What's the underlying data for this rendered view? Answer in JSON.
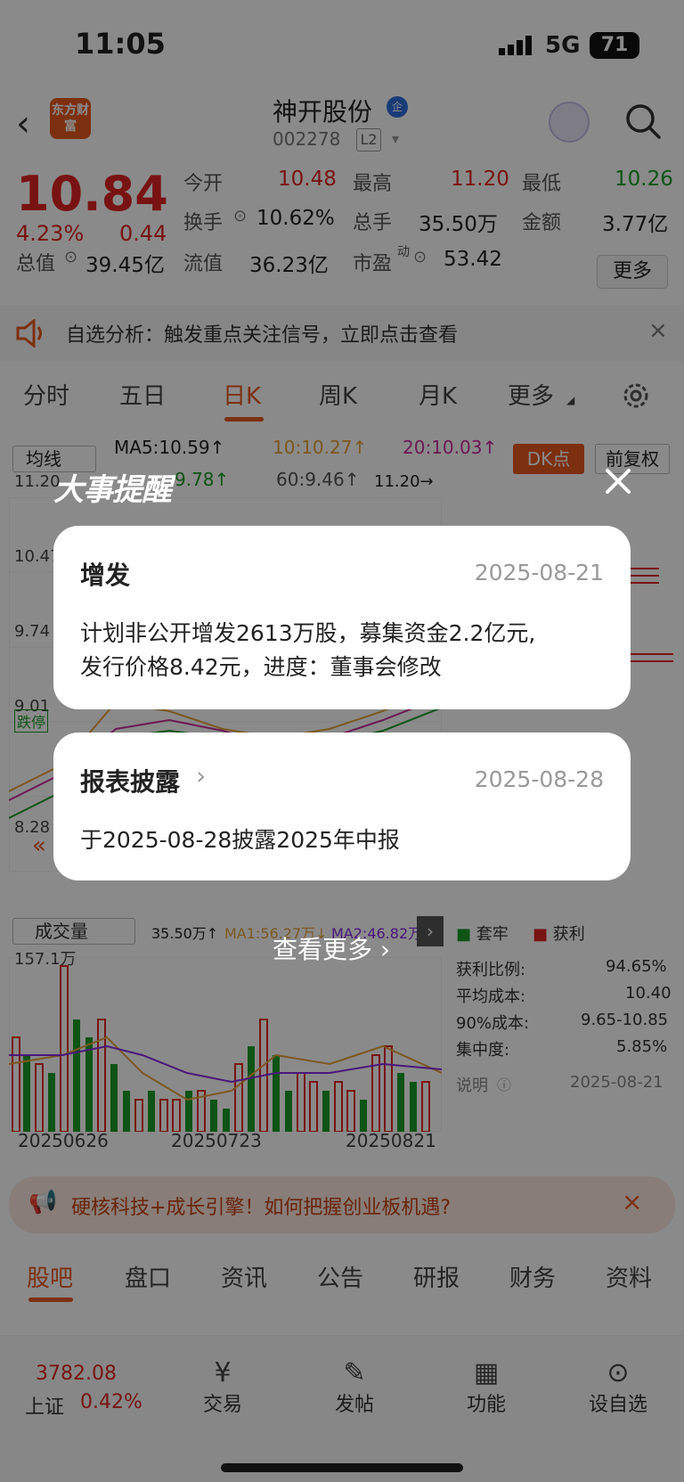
{
  "status_bar": {
    "time": "11:05",
    "network": "5G",
    "battery": "71"
  },
  "header": {
    "logo_text": "东方财富",
    "stock_name": "神开股份",
    "badge": "企",
    "code": "002278",
    "level": "L2"
  },
  "quote": {
    "price": "10.84",
    "change_pct": "4.23%",
    "change": "0.44",
    "open_label": "今开",
    "open": "10.48",
    "high_label": "最高",
    "high": "11.20",
    "low_label": "最低",
    "low": "10.26",
    "turnover_label": "换手",
    "turnover": "10.62%",
    "volume_label": "总手",
    "volume": "35.50万",
    "amount_label": "金额",
    "amount": "3.77亿",
    "mktcap_label": "总值",
    "mktcap": "39.45亿",
    "float_label": "流值",
    "float": "36.23亿",
    "pe_label": "市盈",
    "pe_sup": "动",
    "pe": "53.42",
    "more": "更多"
  },
  "banner_top": {
    "text": "自选分析：触发重点关注信号，立即点击查看"
  },
  "chart_tabs": [
    "分时",
    "五日",
    "日K",
    "周K",
    "月K",
    "更多"
  ],
  "chart": {
    "indicator": "均线",
    "ma5": "MA5:10.59↑",
    "ma10": "10:10.27↑",
    "ma20": "20:10.03↑",
    "ma30": "9.78↑",
    "ma60": "60:9.46↑",
    "dk": "DK点",
    "adjust": "前复权",
    "y_labels": [
      "11.20",
      "10.47",
      "9.74",
      "9.01",
      "8.28"
    ],
    "high_mark": "11.20→",
    "limit_down": "跌停",
    "volume_select": "成交量",
    "vol_total": "35.50万↑",
    "vol_ma1": "MA1:56.27万↓",
    "vol_ma2": "MA2:46.82万",
    "vol_max": "157.1万",
    "dates": [
      "20250626",
      "20250723",
      "20250821"
    ]
  },
  "chip": {
    "legend_trap": "套牢",
    "legend_profit": "获利",
    "rows": [
      {
        "label": "获利比例:",
        "value": "94.65%"
      },
      {
        "label": "平均成本:",
        "value": "10.40"
      },
      {
        "label": "90%成本:",
        "value": "9.65-10.85"
      },
      {
        "label": "集中度:",
        "value": "5.85%"
      }
    ],
    "note_label": "说明",
    "note_date": "2025-08-21"
  },
  "banner_bottom": {
    "text": "硬核科技+成长引擎！如何把握创业板机遇?"
  },
  "bottom_tabs": [
    "股吧",
    "盘口",
    "资讯",
    "公告",
    "研报",
    "财务",
    "资料"
  ],
  "bottom_nav": {
    "index_value": "3782.08",
    "index_name": "上证",
    "index_pct": "0.42%",
    "items": [
      "交易",
      "发帖",
      "功能",
      "设自选"
    ]
  },
  "modal": {
    "title": "大事提醒",
    "card1": {
      "title": "增发",
      "date": "2025-08-21",
      "body1": "计划非公开增发2613万股，募集资金2.2亿元,",
      "body2": "发行价格8.42元，进度：董事会修改"
    },
    "card2": {
      "title": "报表披露",
      "date": "2025-08-28",
      "body": "于2025-08-28披露2025年中报"
    },
    "see_more": "查看更多"
  },
  "colors": {
    "accent": "#e85a1c",
    "up": "#e02424",
    "down": "#1a9c2a"
  }
}
